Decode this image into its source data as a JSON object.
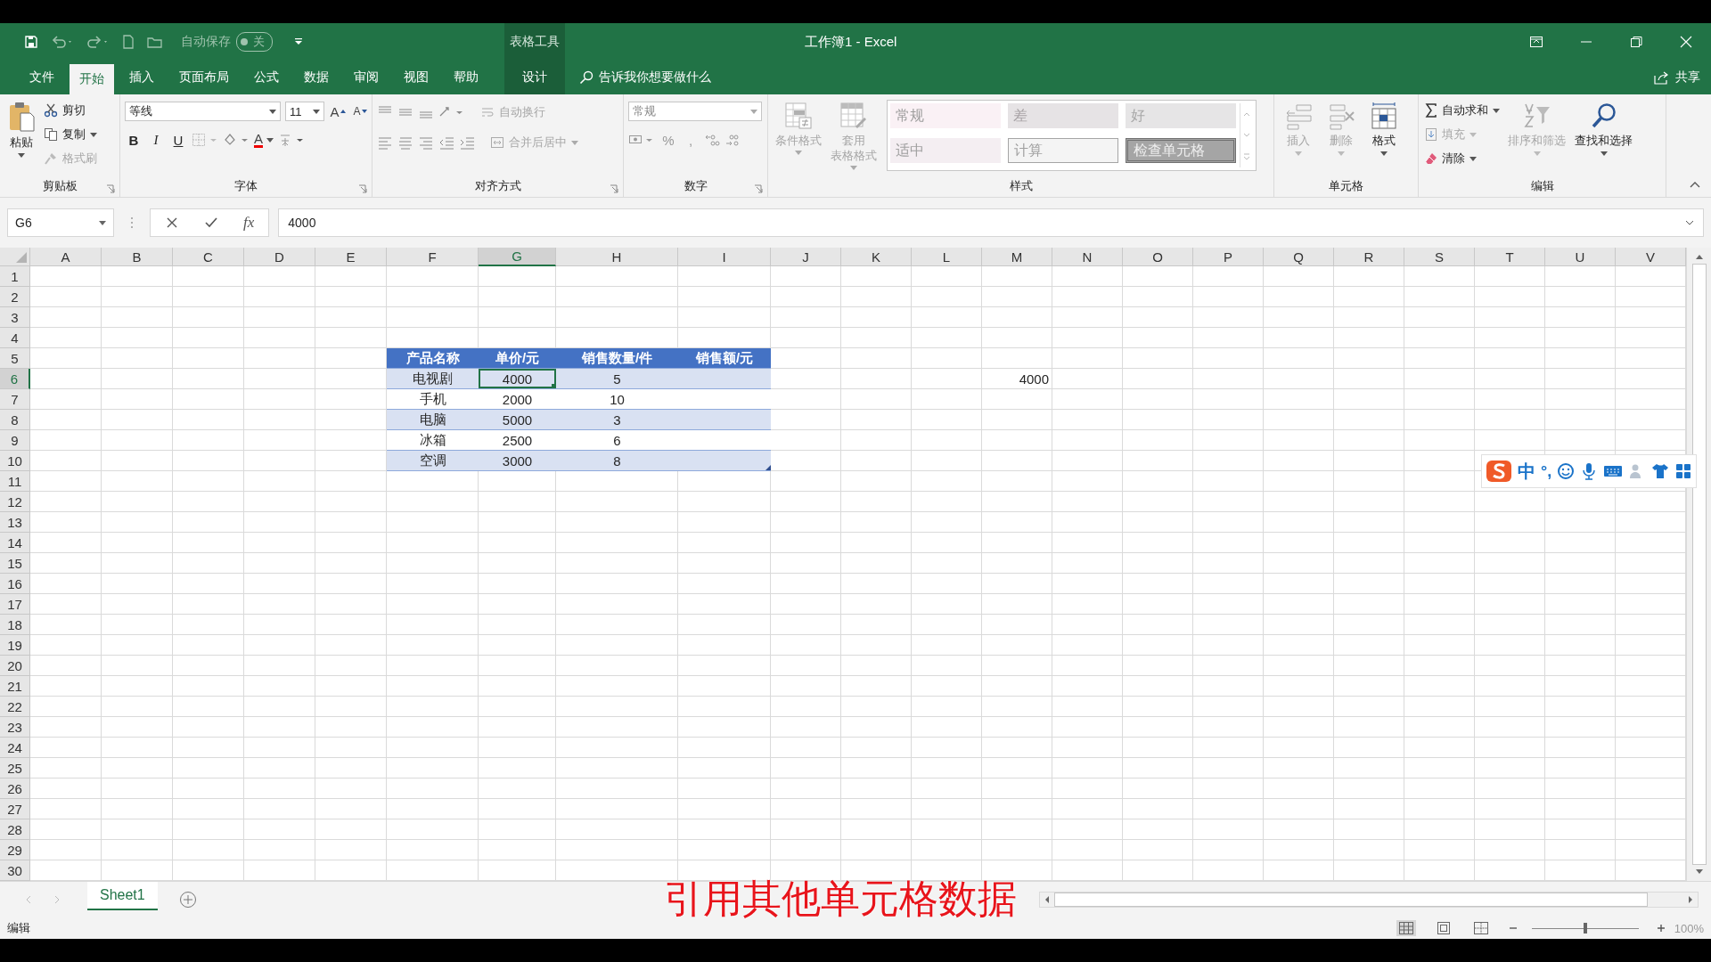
{
  "title_bar": {
    "autosave_label": "自动保存",
    "autosave": {
      "on": false,
      "label": "关"
    },
    "context_label": "表格工具",
    "title": "工作簿1 - Excel"
  },
  "tabs": [
    {
      "label": "文件",
      "selected": false,
      "contextual": false
    },
    {
      "label": "开始",
      "selected": true,
      "contextual": false
    },
    {
      "label": "插入",
      "selected": false,
      "contextual": false
    },
    {
      "label": "页面布局",
      "selected": false,
      "contextual": false
    },
    {
      "label": "公式",
      "selected": false,
      "contextual": false
    },
    {
      "label": "数据",
      "selected": false,
      "contextual": false
    },
    {
      "label": "审阅",
      "selected": false,
      "contextual": false
    },
    {
      "label": "视图",
      "selected": false,
      "contextual": false
    },
    {
      "label": "帮助",
      "selected": false,
      "contextual": false
    },
    {
      "label": "设计",
      "selected": false,
      "contextual": true
    }
  ],
  "tell_me": {
    "placeholder": "告诉我你想要做什么"
  },
  "share": "共享",
  "ribbon": {
    "groups": [
      {
        "kind": "clipboard",
        "label": "剪贴板",
        "paste": "粘贴",
        "items": [
          {
            "label": "剪切",
            "disabled": false
          },
          {
            "label": "复制",
            "disabled": false
          },
          {
            "label": "格式刷",
            "disabled": true
          }
        ]
      },
      {
        "kind": "font",
        "label": "字体",
        "font_name": "等线",
        "font_size": "11",
        "grow": "A",
        "shrink": "A",
        "styles": [
          "B",
          "I",
          "U"
        ],
        "font_color": "A"
      },
      {
        "kind": "alignment",
        "label": "对齐方式",
        "wrap": {
          "label": "自动换行",
          "disabled": true
        },
        "merge": {
          "label": "合并后居中",
          "disabled": true
        }
      },
      {
        "kind": "number",
        "label": "数字",
        "format": "常规",
        "percent": "%",
        "comma": ","
      },
      {
        "kind": "styles",
        "label": "样式",
        "buttons": [
          {
            "lines": [
              "条件格式"
            ],
            "disabled": true
          },
          {
            "lines": [
              "套用",
              "表格格式"
            ],
            "disabled": true
          }
        ],
        "gallery": [
          {
            "label": "常规",
            "kind": "normal"
          },
          {
            "label": "差",
            "kind": "bad"
          },
          {
            "label": "好",
            "kind": "good"
          },
          {
            "label": "适中",
            "kind": "neutral"
          },
          {
            "label": "计算",
            "kind": "calculation"
          },
          {
            "label": "检查单元格",
            "kind": "check"
          }
        ]
      },
      {
        "kind": "cells",
        "label": "单元格",
        "buttons": [
          {
            "label": "插入",
            "disabled": true
          },
          {
            "label": "删除",
            "disabled": true
          },
          {
            "label": "格式",
            "disabled": false
          }
        ]
      },
      {
        "kind": "editing",
        "label": "编辑",
        "items": [
          {
            "label": "自动求和",
            "disabled": false
          },
          {
            "label": "填充",
            "disabled": true
          },
          {
            "label": "清除",
            "disabled": false
          }
        ],
        "buttons": [
          {
            "label": "排序和筛选",
            "disabled": true
          },
          {
            "label": "查找和选择",
            "disabled": false
          }
        ]
      }
    ]
  },
  "formula_bar": {
    "name_box": "G6",
    "function_button": "fx",
    "value": "4000"
  },
  "grid": {
    "columns": [
      {
        "label": "A",
        "selected": false
      },
      {
        "label": "B",
        "selected": false
      },
      {
        "label": "C",
        "selected": false
      },
      {
        "label": "D",
        "selected": false
      },
      {
        "label": "E",
        "selected": false
      },
      {
        "label": "F",
        "selected": false
      },
      {
        "label": "G",
        "selected": true
      },
      {
        "label": "H",
        "selected": false
      },
      {
        "label": "I",
        "selected": false
      },
      {
        "label": "J",
        "selected": false
      },
      {
        "label": "K",
        "selected": false
      },
      {
        "label": "L",
        "selected": false
      },
      {
        "label": "M",
        "selected": false
      },
      {
        "label": "N",
        "selected": false
      },
      {
        "label": "O",
        "selected": false
      },
      {
        "label": "P",
        "selected": false
      },
      {
        "label": "Q",
        "selected": false
      },
      {
        "label": "R",
        "selected": false
      },
      {
        "label": "S",
        "selected": false
      },
      {
        "label": "T",
        "selected": false
      },
      {
        "label": "U",
        "selected": false
      },
      {
        "label": "V",
        "selected": false
      }
    ],
    "rows": [
      {
        "label": "1",
        "selected": false
      },
      {
        "label": "2",
        "selected": false
      },
      {
        "label": "3",
        "selected": false
      },
      {
        "label": "4",
        "selected": false
      },
      {
        "label": "5",
        "selected": false,
        "table": {
          "kind": "header",
          "cells": [
            {
              "text": "产品名称"
            },
            {
              "text": "单价/元"
            },
            {
              "text": "销售数量/件"
            },
            {
              "text": "销售额/元"
            }
          ]
        }
      },
      {
        "label": "6",
        "selected": true,
        "table": {
          "kind": "band",
          "cells": [
            {
              "text": "电视剧",
              "selected": false
            },
            {
              "text": "4000",
              "selected": true
            },
            {
              "text": "5",
              "selected": false
            }
          ]
        },
        "values": [
          {
            "text": "4000"
          }
        ]
      },
      {
        "label": "7",
        "selected": false,
        "table": {
          "kind": "plain",
          "cells": [
            {
              "text": "手机",
              "selected": false
            },
            {
              "text": "2000",
              "selected": false
            },
            {
              "text": "10",
              "selected": false
            }
          ]
        }
      },
      {
        "label": "8",
        "selected": false,
        "table": {
          "kind": "band",
          "cells": [
            {
              "text": "电脑",
              "selected": false
            },
            {
              "text": "5000",
              "selected": false
            },
            {
              "text": "3",
              "selected": false
            }
          ]
        }
      },
      {
        "label": "9",
        "selected": false,
        "table": {
          "kind": "plain",
          "cells": [
            {
              "text": "冰箱",
              "selected": false
            },
            {
              "text": "2500",
              "selected": false
            },
            {
              "text": "6",
              "selected": false
            }
          ]
        }
      },
      {
        "label": "10",
        "selected": false,
        "table": {
          "kind": "band",
          "cells": [
            {
              "text": "空调",
              "selected": false
            },
            {
              "text": "3000",
              "selected": false
            },
            {
              "text": "8",
              "selected": false
            }
          ]
        }
      },
      {
        "label": "11",
        "selected": false
      },
      {
        "label": "12",
        "selected": false
      },
      {
        "label": "13",
        "selected": false
      },
      {
        "label": "14",
        "selected": false
      },
      {
        "label": "15",
        "selected": false
      },
      {
        "label": "16",
        "selected": false
      },
      {
        "label": "17",
        "selected": false
      },
      {
        "label": "18",
        "selected": false
      },
      {
        "label": "19",
        "selected": false
      },
      {
        "label": "20",
        "selected": false
      },
      {
        "label": "21",
        "selected": false
      },
      {
        "label": "22",
        "selected": false
      },
      {
        "label": "23",
        "selected": false
      },
      {
        "label": "24",
        "selected": false
      },
      {
        "label": "25",
        "selected": false
      },
      {
        "label": "26",
        "selected": false
      },
      {
        "label": "27",
        "selected": false
      },
      {
        "label": "28",
        "selected": false
      },
      {
        "label": "29",
        "selected": false
      },
      {
        "label": "30",
        "selected": false
      }
    ]
  },
  "ime_bar": {
    "mode": "中",
    "punctuation": "°,"
  },
  "sheet_tabs": [
    {
      "label": "Sheet1",
      "selected": true
    }
  ],
  "caption": "引用其他单元格数据",
  "status_bar": {
    "mode": "编辑",
    "views": [
      {
        "selected": true
      },
      {
        "selected": false
      },
      {
        "selected": false
      }
    ],
    "zoom": {
      "level": 0.5,
      "reading": "100%"
    }
  }
}
